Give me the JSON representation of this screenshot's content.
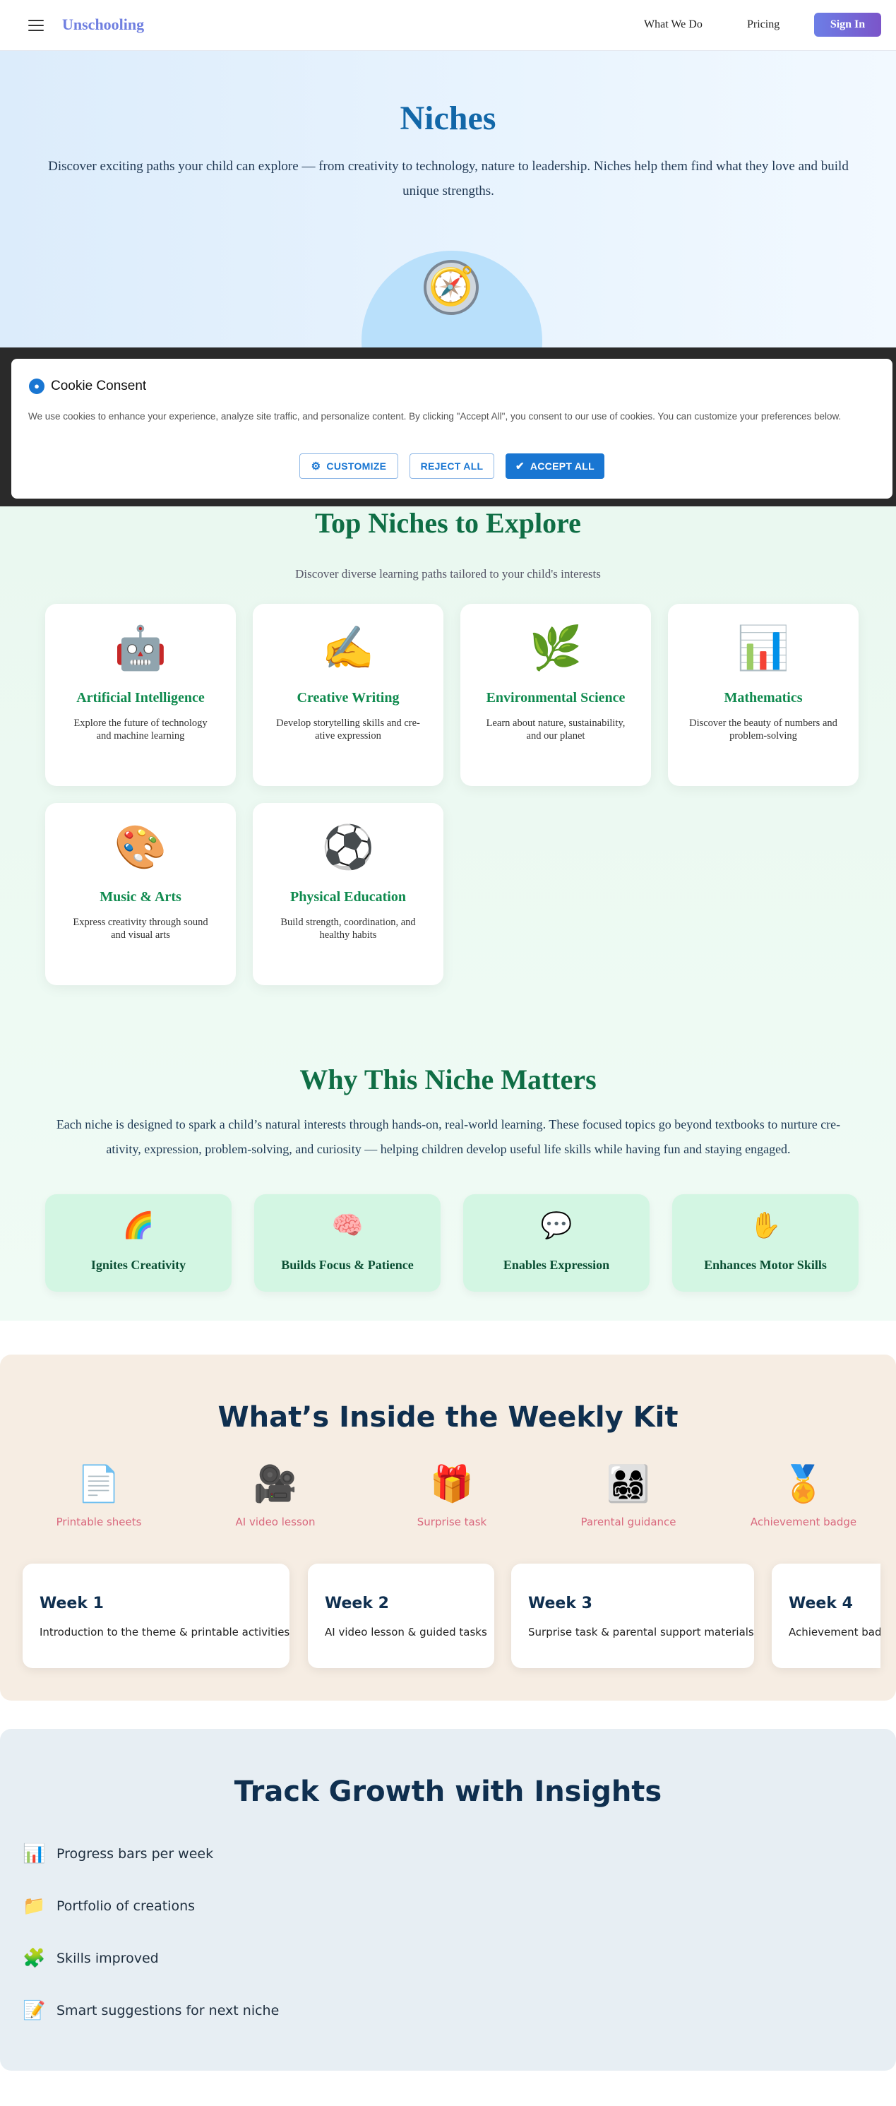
{
  "header": {
    "logo": "Unschooling",
    "nav": [
      {
        "label": "What We Do"
      },
      {
        "label": "Pricing"
      }
    ],
    "signin_label": "Sign In"
  },
  "hero": {
    "title": "Niches",
    "description": "Discover exciting paths your child can explore — from creativity to technology, nature to leadership. Niches help them find what they love and build unique strengths.",
    "icon": "compass-icon",
    "icon_glyph": "🧭"
  },
  "cookie": {
    "title": "Cookie Consent",
    "text": "We use cookies to enhance your experience, analyze site traffic, and personalize content. By clicking \"Accept All\", you consent to our use of cookies. You can customize your preferences below.",
    "customize_label": "CUSTOMIZE",
    "reject_label": "REJECT ALL",
    "accept_label": "ACCEPT ALL",
    "accent": "#1976d2"
  },
  "top_niches": {
    "title": "Top Niches to Explore",
    "subtitle": "Discover diverse learning paths tailored to your child's interests",
    "items": [
      {
        "emoji": "🤖",
        "name": "Artificial Intelligence",
        "desc": "Explore the future of technology and machine learning"
      },
      {
        "emoji": "✍️",
        "name": "Creative Writing",
        "desc": "Develop storytelling skills and cre-ative expression"
      },
      {
        "emoji": "🌿",
        "name": "Environmental Science",
        "desc": "Learn about nature, sustainability, and our planet"
      },
      {
        "emoji": "📊",
        "name": "Mathematics",
        "desc": "Discover the beauty of numbers and problem-solving"
      },
      {
        "emoji": "🎨",
        "name": "Music & Arts",
        "desc": "Express creativity through sound and visual arts"
      },
      {
        "emoji": "⚽",
        "name": "Physical Education",
        "desc": "Build strength, coordination, and healthy habits"
      }
    ]
  },
  "why": {
    "title": "Why This Niche Matters",
    "description": "Each niche is designed to spark a child’s natural interests through hands-on, real-world learning. These focused topics go beyond textbooks to nurture cre-ativity, expression, problem-solving, and curiosity — helping children develop useful life skills while having fun and staying engaged.",
    "items": [
      {
        "emoji": "🌈",
        "name": "Ignites Creativity"
      },
      {
        "emoji": "🧠",
        "name": "Builds Focus & Patience"
      },
      {
        "emoji": "💬",
        "name": "Enables Expression"
      },
      {
        "emoji": "✋",
        "name": "Enhances Motor Skills"
      }
    ]
  },
  "kit": {
    "title": "What’s Inside the Weekly Kit",
    "items": [
      {
        "emoji": "📄",
        "label": "Printable sheets"
      },
      {
        "emoji": "🎥",
        "label": "AI video lesson"
      },
      {
        "emoji": "🎁",
        "label": "Surprise task"
      },
      {
        "emoji": "👨‍👩‍👧‍👦",
        "label": "Parental guidance"
      },
      {
        "emoji": "🏅",
        "label": "Achievement badge"
      }
    ],
    "weeks": [
      {
        "title": "Week 1",
        "desc": "Introduction to the theme & printable activities"
      },
      {
        "title": "Week 2",
        "desc": "AI video lesson & guided tasks"
      },
      {
        "title": "Week 3",
        "desc": "Surprise task & parental support materials"
      },
      {
        "title": "Week 4",
        "desc": "Achievement badg"
      }
    ]
  },
  "track": {
    "title": "Track Growth with Insights",
    "items": [
      {
        "emoji": "📊",
        "label": "Progress bars per week"
      },
      {
        "emoji": "📁",
        "label": "Portfolio of creations"
      },
      {
        "emoji": "🧩",
        "label": "Skills improved"
      },
      {
        "emoji": "📝",
        "label": "Smart suggestions for next niche"
      }
    ]
  }
}
